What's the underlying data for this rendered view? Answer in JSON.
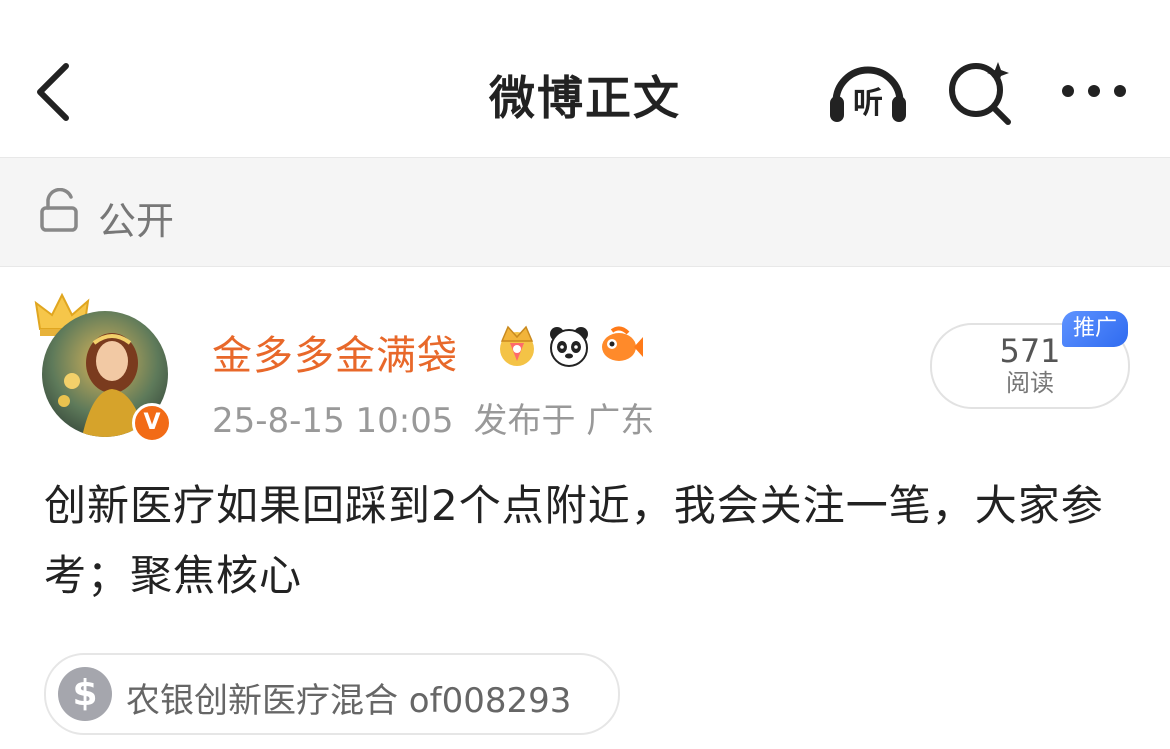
{
  "navbar": {
    "title": "微博正文",
    "listen_label": "听",
    "icons": [
      "back-icon",
      "listen-icon",
      "search-icon",
      "more-icon"
    ]
  },
  "visibility": {
    "label": "公开",
    "icon": "unlock-icon"
  },
  "post": {
    "username": "金多多金满袋",
    "verified_badge": "V",
    "timestamp": "25-8-15 10:05",
    "location": "发布于 广东",
    "reads": {
      "count": "571",
      "label": "阅读"
    },
    "promo_tag": "推广",
    "text": "创新医疗如果回踩到2个点附近，我会关注一笔，大家参考；聚焦核心",
    "fund_tag": {
      "icon_text": "$",
      "label": "农银创新医疗混合 of008293"
    }
  },
  "colors": {
    "username": "#e8682a",
    "badge_orange": "#f26b16",
    "promo_blue": "#3d78f4",
    "muted_text": "#999999"
  }
}
